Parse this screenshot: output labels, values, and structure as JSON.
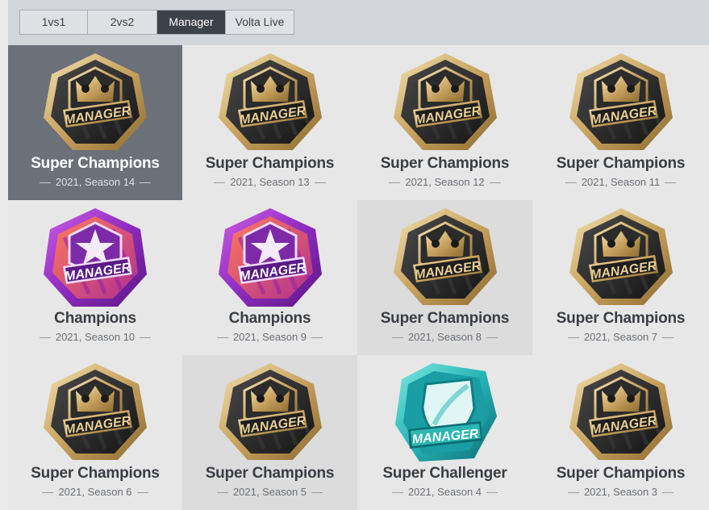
{
  "tabs": [
    {
      "label": "1vs1"
    },
    {
      "label": "2vs2"
    },
    {
      "label": "Manager",
      "active": true
    },
    {
      "label": "Volta Live"
    }
  ],
  "badge_text": "MANAGER",
  "colors": {
    "gold": "#d8b46a",
    "purple": "#9d3bc9",
    "teal": "#2ab8b8",
    "selected_bg": "#6b7079"
  },
  "achievements": [
    {
      "title": "Super Champions",
      "season": "2021, Season 14",
      "badge": "gold-crown-badge",
      "selected": true
    },
    {
      "title": "Super Champions",
      "season": "2021, Season 13",
      "badge": "gold-crown-badge"
    },
    {
      "title": "Super Champions",
      "season": "2021, Season 12",
      "badge": "gold-crown-badge"
    },
    {
      "title": "Super Champions",
      "season": "2021, Season 11",
      "badge": "gold-crown-badge"
    },
    {
      "title": "Champions",
      "season": "2021, Season 10",
      "badge": "purple-star-badge"
    },
    {
      "title": "Champions",
      "season": "2021, Season 9",
      "badge": "purple-star-badge"
    },
    {
      "title": "Super Champions",
      "season": "2021, Season 8",
      "badge": "gold-crown-badge"
    },
    {
      "title": "Super Champions",
      "season": "2021, Season 7",
      "badge": "gold-crown-badge"
    },
    {
      "title": "Super Champions",
      "season": "2021, Season 6",
      "badge": "gold-crown-badge"
    },
    {
      "title": "Super Champions",
      "season": "2021, Season 5",
      "badge": "gold-crown-badge"
    },
    {
      "title": "Super Challenger",
      "season": "2021, Season 4",
      "badge": "teal-shield-badge"
    },
    {
      "title": "Super Champions",
      "season": "2021, Season 3",
      "badge": "gold-crown-badge"
    }
  ]
}
